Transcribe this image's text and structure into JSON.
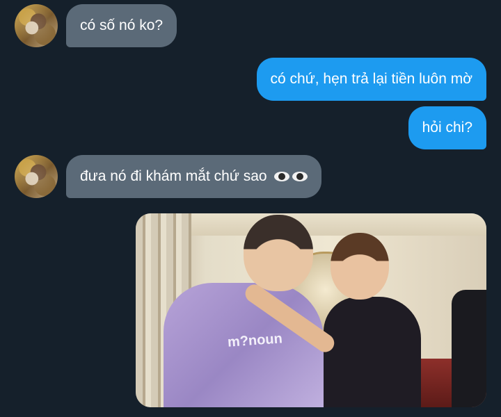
{
  "messages": [
    {
      "side": "in",
      "text": "có số nó ko?"
    },
    {
      "side": "out",
      "text": "có chứ, hẹn trả lại tiền luôn mờ"
    },
    {
      "side": "out",
      "text": "hỏi chi?"
    },
    {
      "side": "in",
      "text": "đưa nó đi khám mắt chứ sao",
      "emoji": "eyes-emoji"
    }
  ],
  "photo": {
    "shirt_text": "m?noun"
  },
  "colors": {
    "background": "#15202b",
    "incoming_bubble": "#5b6a78",
    "outgoing_bubble": "#1d9bf0"
  }
}
